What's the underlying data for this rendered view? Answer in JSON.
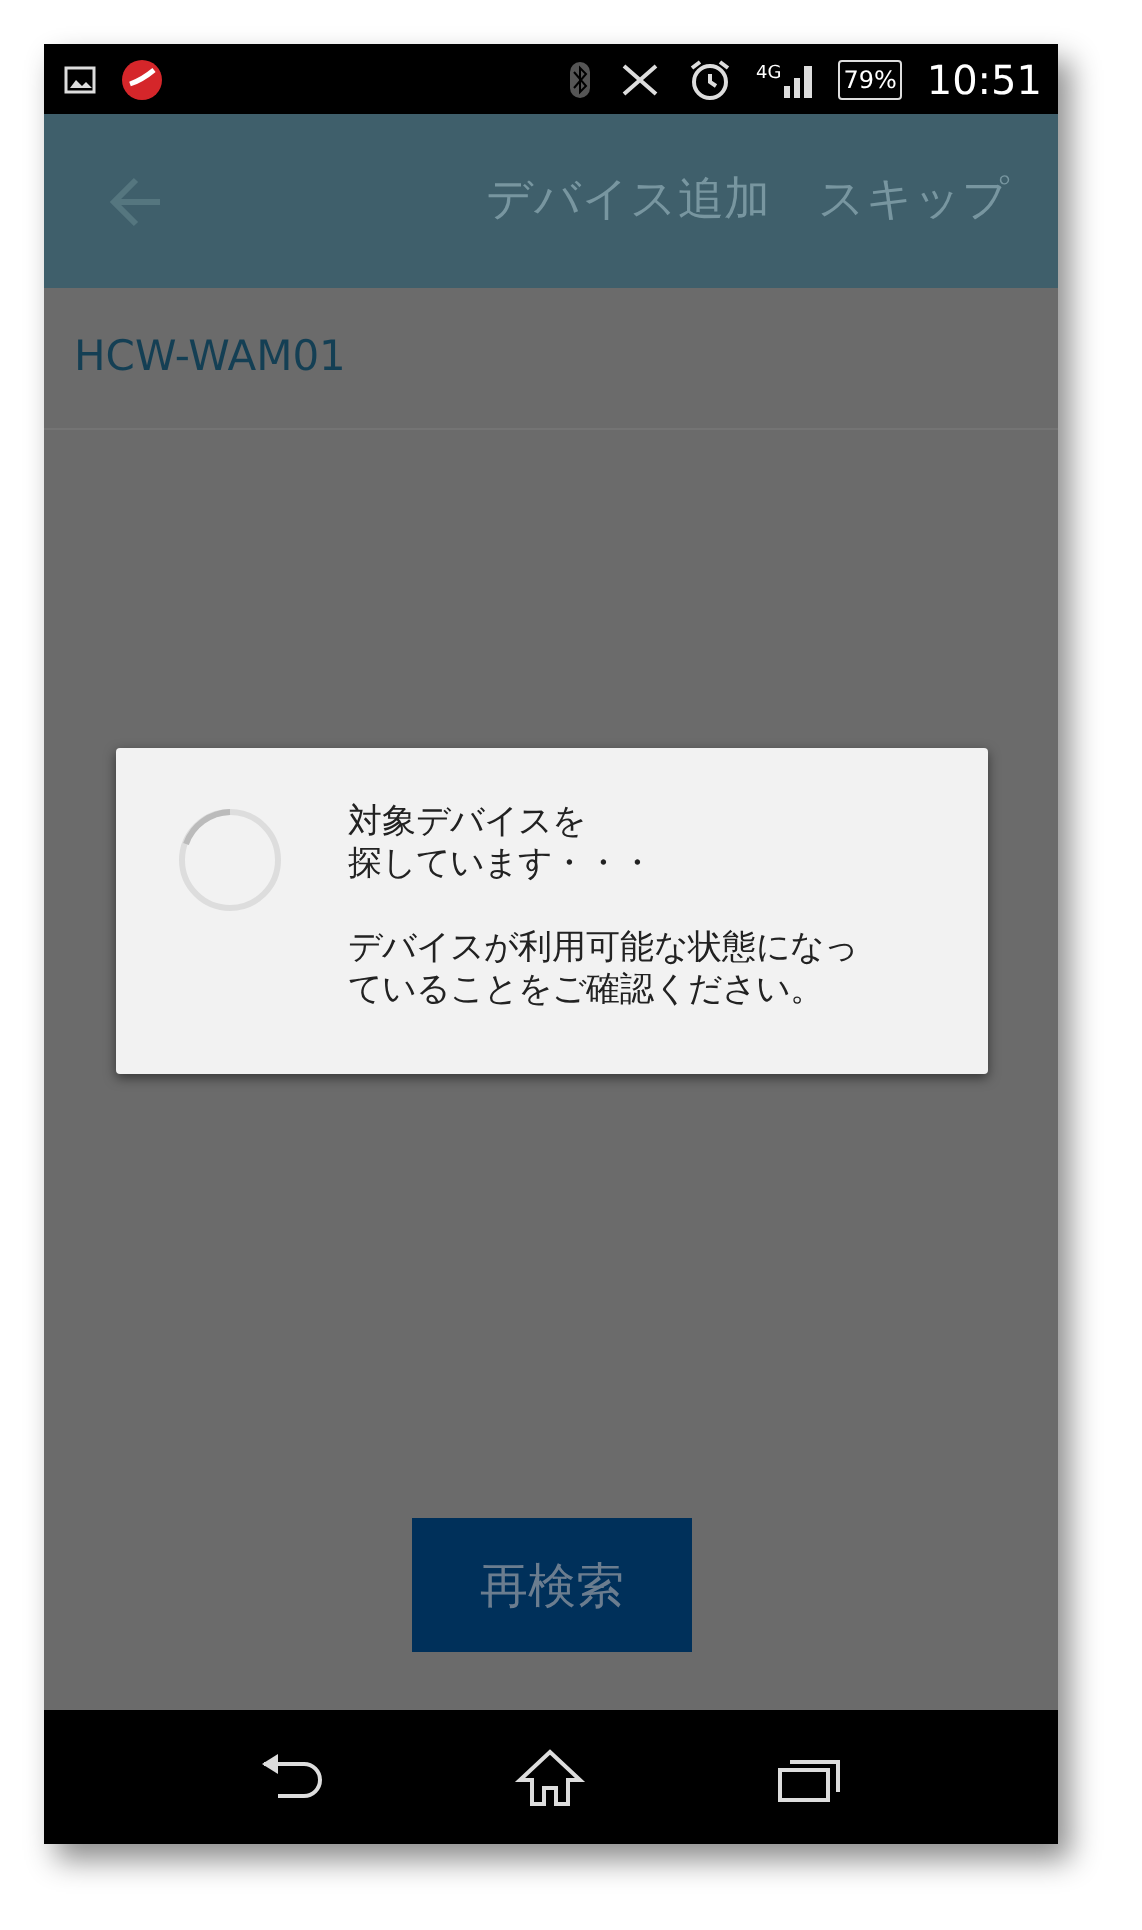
{
  "status_bar": {
    "network": "4G",
    "battery": "79%",
    "time": "10:51"
  },
  "app_bar": {
    "title": "デバイス追加",
    "action": "スキップ"
  },
  "devices": [
    {
      "name": "HCW-WAM01"
    }
  ],
  "dialog": {
    "messages": [
      {
        "lines": [
          "対象デバイスを",
          "探しています・・・"
        ]
      },
      {
        "lines": [
          "デバイスが利用可能な状態になっ",
          "ていることをご確認ください。"
        ]
      }
    ]
  },
  "button": "再検索"
}
